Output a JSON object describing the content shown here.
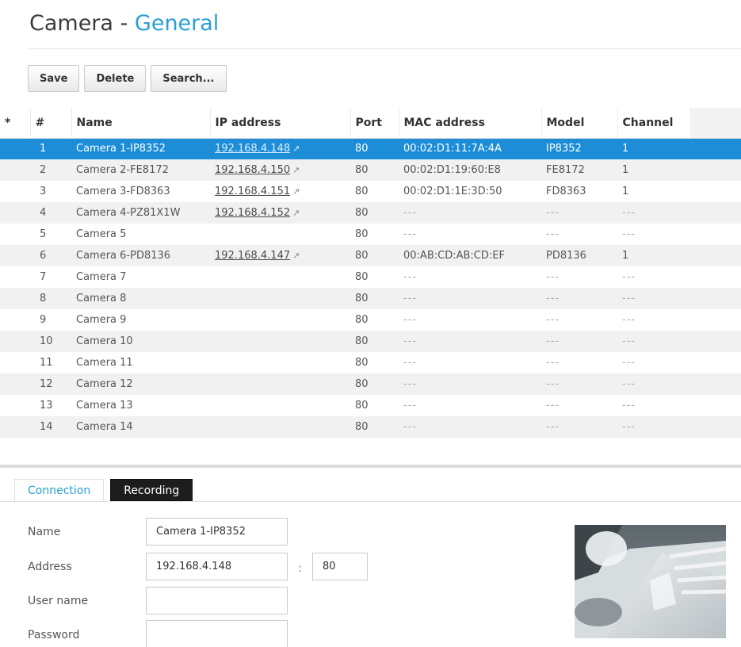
{
  "page": {
    "title_prefix": "Camera",
    "title_sep": "-",
    "title_section": "General"
  },
  "toolbar": {
    "save_label": "Save",
    "delete_label": "Delete",
    "search_label": "Search..."
  },
  "table": {
    "columns": [
      "*",
      "#",
      "Name",
      "IP address",
      "Port",
      "MAC address",
      "Model",
      "Channel"
    ],
    "selected_row": 0,
    "rows": [
      {
        "num": "1",
        "name": "Camera 1-IP8352",
        "ip": "192.168.4.148",
        "port": "80",
        "mac": "00:02:D1:11:7A:4A",
        "model": "IP8352",
        "channel": "1"
      },
      {
        "num": "2",
        "name": "Camera 2-FE8172",
        "ip": "192.168.4.150",
        "port": "80",
        "mac": "00:02:D1:19:60:E8",
        "model": "FE8172",
        "channel": "1"
      },
      {
        "num": "3",
        "name": "Camera 3-FD8363",
        "ip": "192.168.4.151",
        "port": "80",
        "mac": "00:02:D1:1E:3D:50",
        "model": "FD8363",
        "channel": "1"
      },
      {
        "num": "4",
        "name": "Camera 4-PZ81X1W",
        "ip": "192.168.4.152",
        "port": "80",
        "mac": "---",
        "model": "---",
        "channel": "---"
      },
      {
        "num": "5",
        "name": "Camera 5",
        "ip": "",
        "port": "80",
        "mac": "---",
        "model": "---",
        "channel": "---"
      },
      {
        "num": "6",
        "name": "Camera 6-PD8136",
        "ip": "192.168.4.147",
        "port": "80",
        "mac": "00:AB:CD:AB:CD:EF",
        "model": "PD8136",
        "channel": "1"
      },
      {
        "num": "7",
        "name": "Camera 7",
        "ip": "",
        "port": "80",
        "mac": "---",
        "model": "---",
        "channel": "---"
      },
      {
        "num": "8",
        "name": "Camera 8",
        "ip": "",
        "port": "80",
        "mac": "---",
        "model": "---",
        "channel": "---"
      },
      {
        "num": "9",
        "name": "Camera 9",
        "ip": "",
        "port": "80",
        "mac": "---",
        "model": "---",
        "channel": "---"
      },
      {
        "num": "10",
        "name": "Camera 10",
        "ip": "",
        "port": "80",
        "mac": "---",
        "model": "---",
        "channel": "---"
      },
      {
        "num": "11",
        "name": "Camera 11",
        "ip": "",
        "port": "80",
        "mac": "---",
        "model": "---",
        "channel": "---"
      },
      {
        "num": "12",
        "name": "Camera 12",
        "ip": "",
        "port": "80",
        "mac": "---",
        "model": "---",
        "channel": "---"
      },
      {
        "num": "13",
        "name": "Camera 13",
        "ip": "",
        "port": "80",
        "mac": "---",
        "model": "---",
        "channel": "---"
      },
      {
        "num": "14",
        "name": "Camera 14",
        "ip": "",
        "port": "80",
        "mac": "---",
        "model": "---",
        "channel": "---"
      }
    ]
  },
  "tabs": {
    "connection_label": "Connection",
    "recording_label": "Recording",
    "active": "Connection"
  },
  "form": {
    "name_label": "Name",
    "name_value": "Camera 1-IP8352",
    "address_label": "Address",
    "address_value": "192.168.4.148",
    "port_separator": ":",
    "port_value": "80",
    "username_label": "User name",
    "username_value": "",
    "password_label": "Password",
    "password_value": ""
  },
  "colors": {
    "accent": "#2a9fd6",
    "selected_row": "#1e8dd8",
    "recording_tab": "#1d1d1d"
  },
  "icons": {
    "external_link": "external-link-icon"
  }
}
